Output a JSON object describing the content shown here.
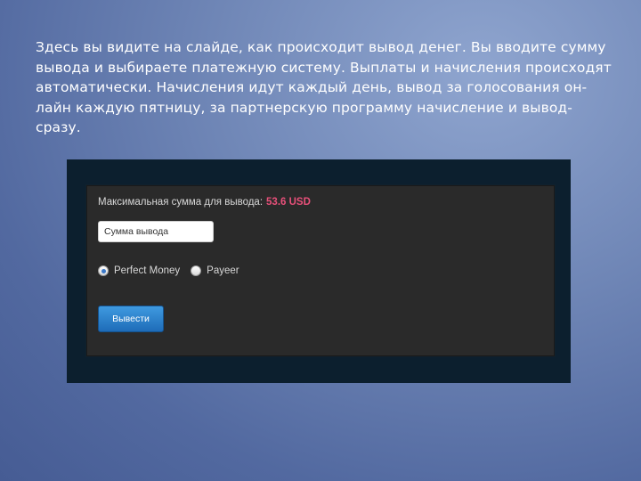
{
  "slide": {
    "text": "Здесь вы видите на слайде, как происходит вывод денег. Вы вводите сумму вывода и выбираете платежную систему. Выплаты и начисления происходят автоматически. Начисления идут каждый день, вывод за голосования он-лайн каждую пятницу, за партнерскую программу начисление и вывод-сразу."
  },
  "withdraw_form": {
    "max_label": "Максимальная сумма для вывода:",
    "max_value": "53.6 USD",
    "amount_placeholder": "Сумма вывода",
    "payment_options": [
      {
        "label": "Perfect Money",
        "selected": true
      },
      {
        "label": "Payeer",
        "selected": false
      }
    ],
    "submit_label": "Вывести"
  },
  "colors": {
    "max_value": "#e8507a",
    "button": "#2a80cc"
  }
}
